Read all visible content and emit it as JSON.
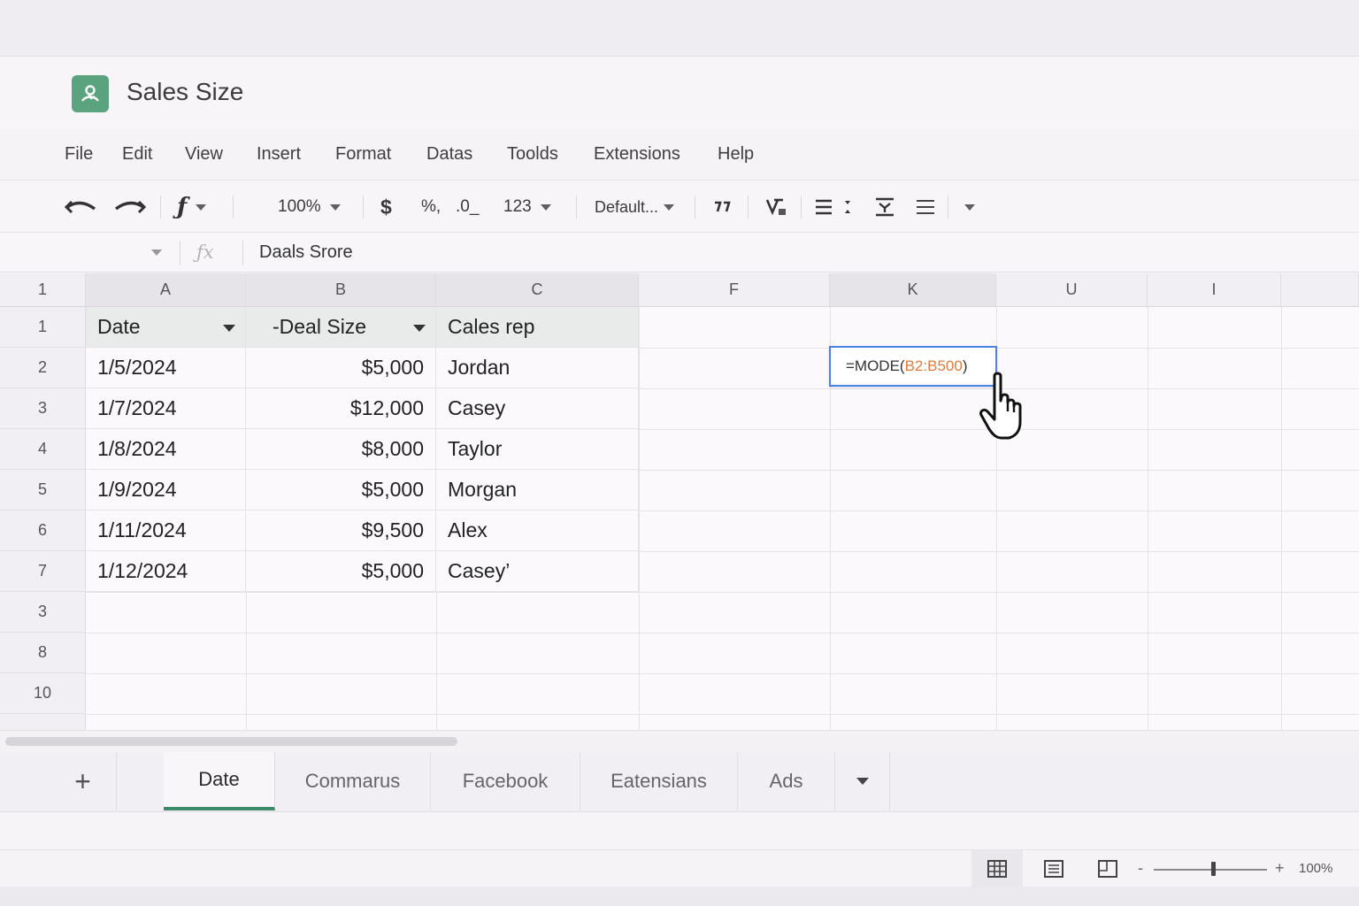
{
  "app": {
    "title": "Sales Size"
  },
  "menu": [
    "File",
    "Edit",
    "View",
    "Insert",
    "Format",
    "Datas",
    "Toolds",
    "Extensions",
    "Help"
  ],
  "toolbar": {
    "zoom": "100%",
    "currency": "$",
    "percent_format": "%,",
    "decimal_format": ".0_",
    "number_format": "123",
    "font": "Default..."
  },
  "formula_bar": {
    "fx": "ƒx",
    "content": "Daals Srore"
  },
  "columns": [
    "A",
    "B",
    "C",
    "F",
    "K",
    "U",
    "I"
  ],
  "corner_label": "1",
  "rows": [
    "1",
    "2",
    "3",
    "4",
    "5",
    "6",
    "7",
    "3",
    "8",
    "10"
  ],
  "table": {
    "headers": [
      "Date",
      "-Deal Size",
      "Cales rep"
    ],
    "data": [
      [
        "1/5/2024",
        "$5,000",
        "Jordan"
      ],
      [
        "1/7/2024",
        "$12,000",
        "Casey"
      ],
      [
        "1/8/2024",
        "$8,000",
        "Taylor"
      ],
      [
        "1/9/2024",
        "$5,000",
        "Morgan"
      ],
      [
        "1/11/2024",
        "$9,500",
        "Alex"
      ],
      [
        "1/12/2024",
        "$5,000",
        "Casey’"
      ]
    ]
  },
  "formula_cell": {
    "prefix": "=MODE(",
    "range": "B2:B500",
    "suffix": ")"
  },
  "sheets": {
    "add": "+",
    "tabs": [
      "Date",
      "Commarus",
      "Facebook",
      "Eatensians",
      "Ads"
    ],
    "active": "Date"
  },
  "status": {
    "zoom_label": "100%",
    "zoom_minus": "-",
    "zoom_plus": "+",
    "zoom_level": 0.5
  },
  "colors": {
    "accent_green": "#3b8a68",
    "selection_blue": "#4a83e6",
    "range_orange": "#e07a3a",
    "logo_green": "#5aa37e"
  },
  "icons": [
    "undo-icon",
    "redo-icon",
    "function-icon",
    "quote-icon",
    "clear-format-icon",
    "align-icon",
    "vertical-align-icon",
    "wrap-icon",
    "grid-view-icon",
    "list-view-icon",
    "page-view-icon",
    "hand-cursor-icon"
  ]
}
